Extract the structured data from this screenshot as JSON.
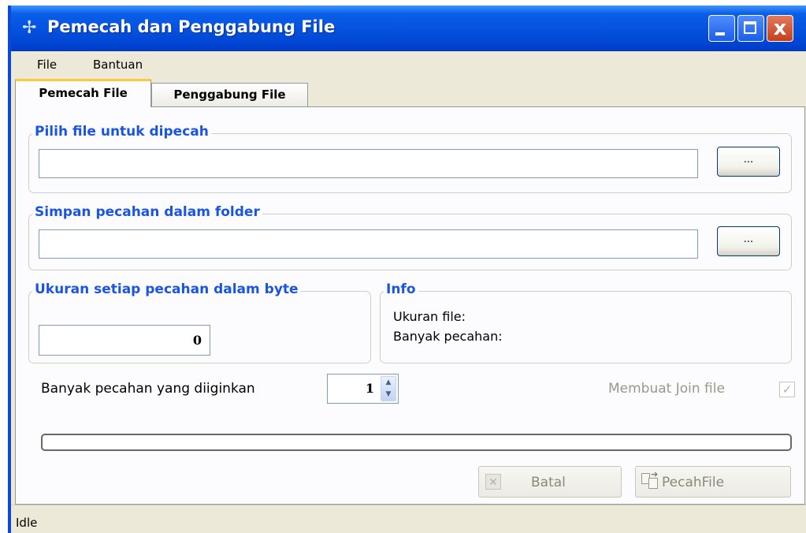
{
  "window": {
    "title": "Pemecah dan Penggabung File",
    "close_glyph": "x",
    "accent_color": "#0553e0"
  },
  "menu": {
    "items": [
      "File",
      "Bantuan"
    ]
  },
  "tabs": [
    "Pemecah File",
    "Penggabung File"
  ],
  "source_group": {
    "legend": "Pilih file untuk dipecah",
    "value": "",
    "browse_label": "..."
  },
  "folder_group": {
    "legend": "Simpan pecahan dalam folder",
    "value": "",
    "browse_label": "..."
  },
  "size_group": {
    "legend": "Ukuran setiap pecahan dalam byte",
    "value": "0"
  },
  "info_group": {
    "legend": "Info",
    "file_size_label": "Ukuran file:",
    "piece_count_label": "Banyak pecahan:"
  },
  "pieces": {
    "label": "Banyak pecahan yang diiginkan",
    "value": "1"
  },
  "join_option": {
    "label": "Membuat Join file",
    "checked": true
  },
  "progress": {
    "value": 0
  },
  "buttons": {
    "cancel": "Batal",
    "split": "PecahFile"
  },
  "status": "Idle",
  "icons": [
    "app-icon",
    "minimize-icon",
    "maximize-icon",
    "close-icon",
    "spin-up-icon",
    "spin-down-icon",
    "check-icon",
    "cancel-icon",
    "split-file-icon"
  ]
}
